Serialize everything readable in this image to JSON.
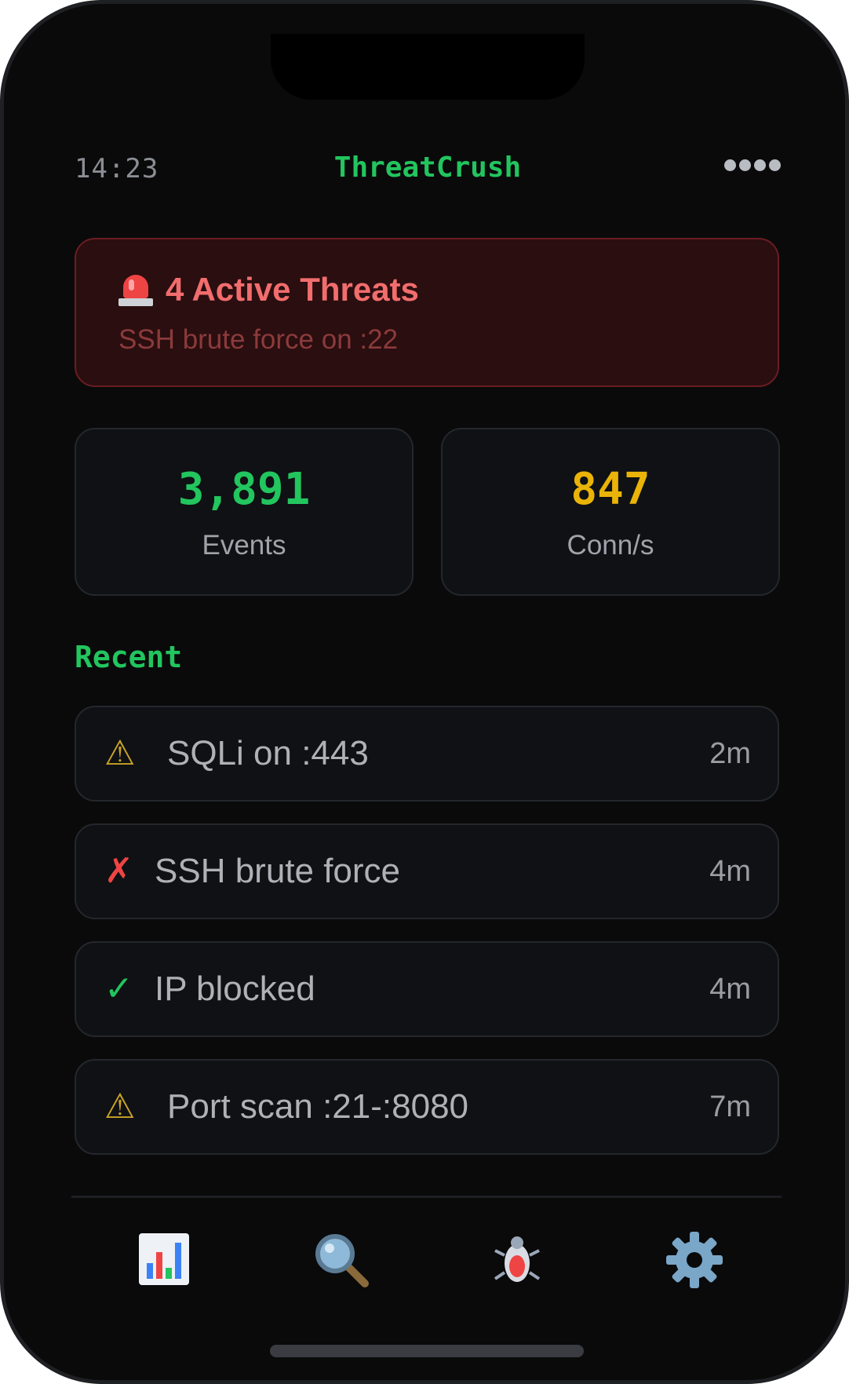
{
  "status_bar": {
    "time": "14:23",
    "app_title": "ThreatCrush",
    "signal_icon": "signal-dots-icon"
  },
  "alert": {
    "icon": "siren-icon",
    "title": "4 Active Threats",
    "subtitle": "SSH brute force on :22",
    "color": "#ef4444"
  },
  "stats": [
    {
      "value": "3,891",
      "label": "Events",
      "color": "#22c55e"
    },
    {
      "value": "847",
      "label": "Conn/s",
      "color": "#eab308"
    }
  ],
  "recent": {
    "title": "Recent",
    "items": [
      {
        "icon": "warning-icon",
        "glyph": "⚠",
        "text": "SQLi on :443",
        "time": "2m"
      },
      {
        "icon": "cross-icon",
        "glyph": "✗",
        "text": "SSH brute force",
        "time": "4m"
      },
      {
        "icon": "check-icon",
        "glyph": "✓",
        "text": "IP blocked",
        "time": "4m"
      },
      {
        "icon": "warning-icon",
        "glyph": "⚠",
        "text": "Port scan :21-:8080",
        "time": "7m"
      }
    ]
  },
  "tab_bar": {
    "tabs": [
      {
        "icon": "bar-chart-icon"
      },
      {
        "icon": "magnifier-icon"
      },
      {
        "icon": "bug-icon"
      },
      {
        "icon": "gear-icon"
      }
    ]
  },
  "colors": {
    "accent_green": "#22c55e",
    "accent_yellow": "#eab308",
    "danger_red": "#ef4444",
    "background": "#0a0a0b"
  }
}
